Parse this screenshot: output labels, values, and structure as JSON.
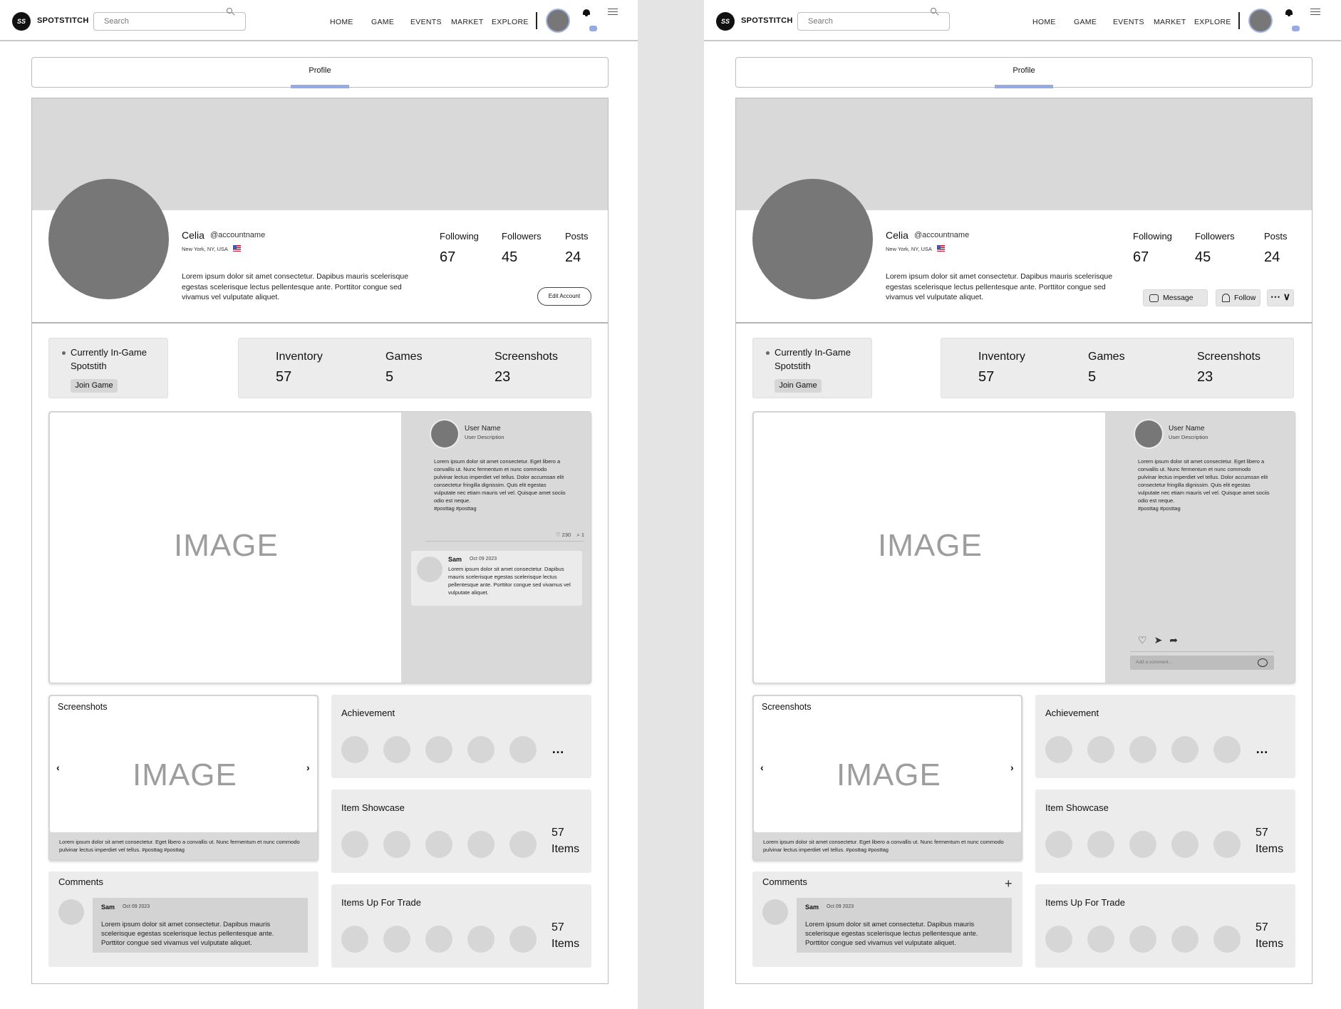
{
  "header": {
    "logo": "SS",
    "brand": "SPOTSTITCH",
    "search_placeholder": "Search",
    "nav": [
      "HOME",
      "GAME",
      "EVENTS",
      "MARKET",
      "EXPLORE"
    ]
  },
  "tab": "Profile",
  "profile": {
    "name": "Celia",
    "handle": "@accountname",
    "location": "New York, NY,  USA",
    "bio": "Lorem ipsum dolor sit amet consectetur. Dapibus mauris scelerisque egestas scelerisque lectus pellentesque ante. Porttitor congue sed vivamus vel vulputate aliquet.",
    "stats": [
      {
        "label": "Following",
        "value": "67"
      },
      {
        "label": "Followers",
        "value": "45"
      },
      {
        "label": "Posts",
        "value": "24"
      }
    ],
    "edit_button": "Edit Account",
    "message_button": "Message",
    "follow_button": "Follow",
    "more_button": "⋯ ∨"
  },
  "in_game": {
    "line1": "Currently In-Game",
    "line2": "Spotstith",
    "join_button": "Join Game"
  },
  "game_stats": [
    {
      "label": "Inventory",
      "value": "57"
    },
    {
      "label": "Games",
      "value": "5"
    },
    {
      "label": "Screenshots",
      "value": "23"
    }
  ],
  "post": {
    "image_placeholder": "IMAGE",
    "user_name": "User Name",
    "user_desc": "User Description",
    "text": "Lorem ipsum dolor sit amet consectetur. Eget libero a convallis ut. Nunc fermentum et nunc commodo pulvinar lectus imperdiet vel tellus. Dolor accumsan elit consectetur fringilla dignissim. Quis elit egestas vulputate nec etiam mauris vel vel. Quisque amet sociis odio est neque.",
    "tags": "#posttag #posttag",
    "likes": "♡ 230",
    "comments": "⌕ 1",
    "comment": {
      "name": "Sam",
      "date": "Oct 09 2023",
      "text": "Lorem ipsum dolor sit amet consectetur. Dapibus mauris scelerisque egestas scelerisque lectus pellentesque ante. Porttitor congue sed vivamus vel vulputate aliquet."
    },
    "add_comment_placeholder": "Add a comment..."
  },
  "screenshots": {
    "title": "Screenshots",
    "image_placeholder": "IMAGE",
    "caption": "Lorem ipsum dolor sit amet consectetur. Eget libero a convallis ut. Nunc fermentum et nunc commodo pulvinar lectus imperdiet vel tellus.  #posttag #posttag"
  },
  "comments_panel": {
    "title": "Comments",
    "name": "Sam",
    "date": "Oct 09 2023",
    "text": "Lorem ipsum dolor sit amet consectetur. Dapibus mauris scelerisque egestas scelerisque lectus pellentesque ante. Porttitor congue sed vivamus vel vulputate aliquet."
  },
  "achievement": {
    "title": "Achievement",
    "more": "…"
  },
  "item_showcase": {
    "title": "Item Showcase",
    "count": "57",
    "unit": "Items"
  },
  "items_trade": {
    "title": "Items Up For Trade",
    "count": "57",
    "unit": "Items"
  },
  "colors": {
    "accent": "#96abe3",
    "placeholder_grey": "#d9d9d9",
    "avatar_grey": "#777777"
  }
}
